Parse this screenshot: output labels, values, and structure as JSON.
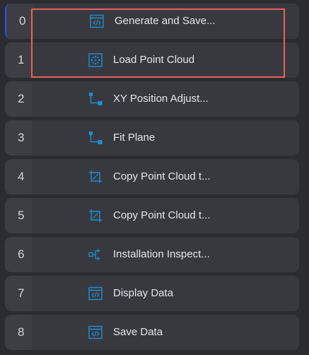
{
  "colors": {
    "background": "#2b2c30",
    "step_bg": "#3d3e43",
    "accent": "#1d8fd6",
    "active_border": "#2f55e8",
    "highlight": "#e8605f"
  },
  "steps": [
    {
      "index": "0",
      "label": "Generate and Save...",
      "icon": "code-window-icon"
    },
    {
      "index": "1",
      "label": "Load Point Cloud",
      "icon": "point-cloud-icon"
    },
    {
      "index": "2",
      "label": "XY Position Adjust...",
      "icon": "transform-icon"
    },
    {
      "index": "3",
      "label": "Fit Plane",
      "icon": "transform-icon"
    },
    {
      "index": "4",
      "label": "Copy Point Cloud t...",
      "icon": "crop-frame-icon"
    },
    {
      "index": "5",
      "label": "Copy Point Cloud t...",
      "icon": "crop-frame-icon"
    },
    {
      "index": "6",
      "label": "Installation Inspect...",
      "icon": "flow-branch-icon"
    },
    {
      "index": "7",
      "label": "Display Data",
      "icon": "code-window-icon"
    },
    {
      "index": "8",
      "label": "Save Data",
      "icon": "code-window-icon"
    }
  ]
}
